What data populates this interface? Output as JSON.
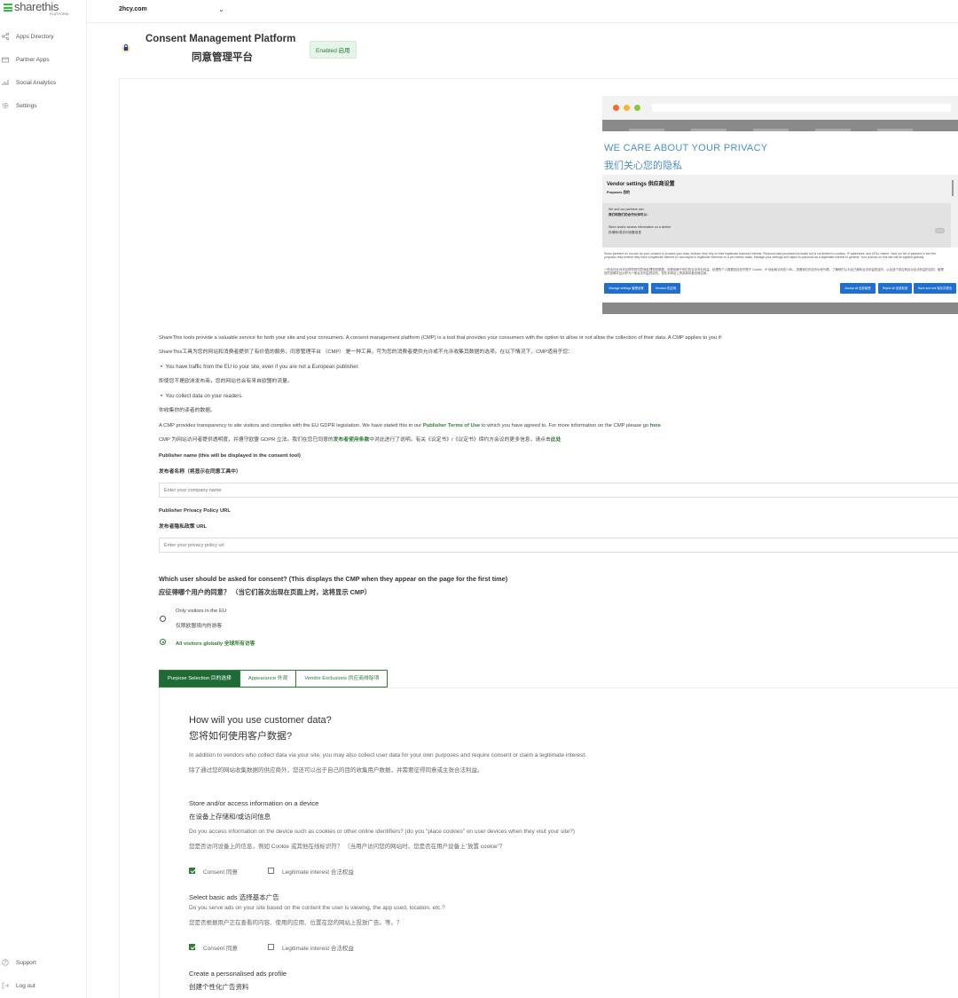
{
  "sidebar": {
    "logo_text": "sharethis",
    "logo_sub": "PLATFORM",
    "items": [
      {
        "label": "Apps Directory",
        "icon": "share-icon"
      },
      {
        "label": "Partner Apps",
        "icon": "box-icon"
      },
      {
        "label": "Social Analytics",
        "icon": "chart-icon"
      },
      {
        "label": "Settings",
        "icon": "gear-icon"
      }
    ],
    "support_label": "Support",
    "logout_label": "Log out"
  },
  "topbar": {
    "domain": "2hcy.com"
  },
  "header": {
    "title_en": "Consent Management Platform",
    "title_zh": "同意管理平台",
    "badge": "Enabled 启用"
  },
  "preview": {
    "h1": "WE CARE ABOUT YOUR PRIVACY",
    "h2": "我们关心您的隐私",
    "vendor_title": "Vendor settings 供应商设置",
    "purposes": "Purposes 目的",
    "partners_en": "We and our partners can:",
    "partners_zh": "我们和我们的合作伙伴可以：",
    "store_en": "Store and/or access information on a device",
    "store_zh": "存储和/或访问设备信息",
    "para_en": "Some partners do not ask for your consent to process your data, instead, they rely on their legitimate business interest. Personal data processed includes but is not limited to cookies, IP addresses, and URLs visited. View our list of partners to see the purposes they believe they have a legitimate interest for and object to legitimate interests on a per vendor basis. Manage your settings and object to purposes as a legitimate interest in general. Your choices on this site will be applied globally.",
    "para_zh": "一些合作伙伴未征得您的同意就处理您的数据，而是依赖于他们的合法商业利益。处理的个人数据包括但不限于 Cookie、IP 地址和访问的 URL。查看我们的合作伙伴列表，了解他们认为自己拥有合法利益的目的，以及逐个供应商反对合法利益的目的。管理您的设置并反对作为一般合法利益的目的。您在本网站上的选择将被全局应用。",
    "buttons": [
      {
        "label": "Manage settings 管理设置"
      },
      {
        "label": "Vendors 供应商"
      },
      {
        "label": "Accept all 全部接受"
      },
      {
        "label": "Reject all 全部拒绝"
      },
      {
        "label": "Save and exit 保存并退出"
      }
    ]
  },
  "intro": {
    "p1_en": "ShareThis tools provide a valuable service for both your site and your consumers. A consent management platform (CMP) is a tool that provides your consumers with the option to allow or not allow the collection of their data. A CMP applies to you if:",
    "p1_zh": "ShareThis工具为您的网站和消费者提供了有价值的服务。同意管理平台 （CMP） 是一种工具，可为您的消费者提供允许或不允许收集其数据的选项。在以下情况下，CMP适用于您：",
    "b1_en": "You have traffic from the EU to your site, even if you are not a European publisher.",
    "b1_zh": "即使您不是欧洲发布商，您的网站也会有来自欧盟的流量。",
    "b2_en": "You collect data on your readers.",
    "b2_zh": "你收集你的读者的数据。",
    "p2_en_a": "A CMP provides transparency to site visitors and complies with the EU GDPR legislation. We have stated this in our ",
    "p2_en_link": "Publisher Terms of Use",
    "p2_en_b": " to which you have agreed to. For more information on the CMP please go ",
    "p2_en_here": "here",
    "p2_zh_a": "CMP 为网站访问者提供透明度，并遵守欧盟 GDPR 立法。我们在您已同意的",
    "p2_zh_link": "发布者使用条款",
    "p2_zh_b": "中对此进行了说明。有关《议定书》/《议定书》缔约方会议的更多信息，请点击",
    "p2_zh_here": "此处"
  },
  "form": {
    "name_label_en": "Publisher name (this will be displayed in the consent tool)",
    "name_label_zh": "发布者名称（将显示在同意工具中）",
    "name_placeholder": "Enter your company name",
    "url_label_en": "Publisher Privacy Policy URL",
    "url_label_zh": "发布者隐私政策 URL",
    "url_placeholder": "Enter your privacy policy url",
    "consent_q_en": "Which user should be asked for consent? (This displays the CMP when they appear on the page for the first time)",
    "consent_q_zh": "应征得哪个用户的同意？ （当它们首次出现在页面上时，这将显示 CMP）",
    "opt1_en": "Only visitors in the EU",
    "opt1_zh": "仅限欧盟境内的游客",
    "opt2": "All visitors globally 全球所有访客"
  },
  "tabs": [
    {
      "label": "Purpose Selection 目的选择"
    },
    {
      "label": "Appearance 外观"
    },
    {
      "label": "Vendor Exclusions 供应商排除项"
    }
  ],
  "purpose": {
    "h_en": "How will you use customer data?",
    "h_zh": "您将如何使用客户数据?",
    "p_en": "In addition to vendors who collect data via your site, you may also collect user data for your own purposes and require consent or claim a legitimate interest.",
    "p_zh": "除了通过您的网站收集数据的供应商外，您还可以出于自己的目的收集用户数据，并需要征得同意或主张合法利益。",
    "s1_en": "Store and/or access information on a device",
    "s1_zh": "在设备上存储和/或访问信息",
    "s1_q_en": "Do you access information on the device such as cookies or other online identifiers? (do you \"place cookies\" on user devices when they visit your site?)",
    "s1_q_zh": "您是否访问设备上的信息，例如 Cookie 或其他在线标识符？ （当用户访问您的网站时，您是否在用户设备上\"放置 cookie\"？",
    "consent": "Consent 同意",
    "legit": "Legitimate interest 合法权益",
    "s2_en": "Select basic ads 选择基本广告",
    "s2_q_en": "Do you serve ads on your site based on the content the user is viewing, the app used, location. etc.?",
    "s2_q_zh": "您是否根据用户正在查看的内容、使用的应用、位置在您的网站上投放广告。等。？",
    "s3_en": "Create a personalised ads profile",
    "s3_zh": "创建个性化广告资料"
  }
}
